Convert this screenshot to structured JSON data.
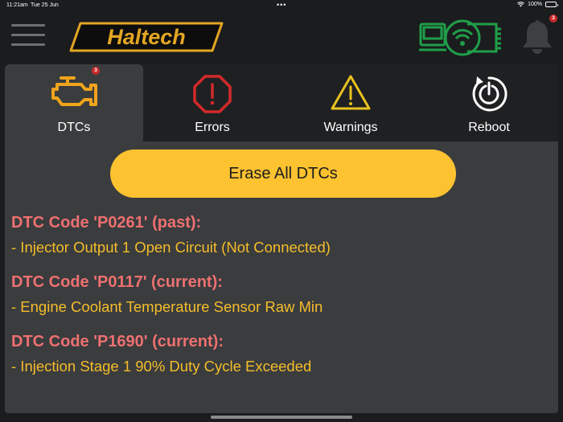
{
  "status_bar": {
    "time": "11:21am",
    "date": "Tue 25 Jun",
    "dots": "•••",
    "battery": "100%"
  },
  "header": {
    "brand": "Haltech",
    "notification_count": "3"
  },
  "colors": {
    "accent_yellow": "#fcc230",
    "dtc_code_red": "#ee7070",
    "dtc_desc_yellow": "#f5bd2a",
    "engine_icon_orange": "#f0a41c",
    "error_icon_red": "#d42a2a",
    "warning_icon_yellow": "#e8c21f",
    "ecu_connected_green": "#1f9e49"
  },
  "tabs": [
    {
      "label": "DTCs",
      "icon": "engine-check-icon",
      "badge": "3",
      "active": true
    },
    {
      "label": "Errors",
      "icon": "error-octagon-icon"
    },
    {
      "label": "Warnings",
      "icon": "warning-triangle-icon"
    },
    {
      "label": "Reboot",
      "icon": "reboot-power-icon"
    }
  ],
  "main": {
    "erase_label": "Erase All DTCs",
    "dtcs": [
      {
        "code": "DTC Code 'P0261' (past):",
        "description": "- Injector Output 1 Open Circuit (Not Connected)"
      },
      {
        "code": "DTC Code 'P0117' (current):",
        "description": "- Engine Coolant Temperature Sensor Raw Min"
      },
      {
        "code": "DTC Code 'P1690' (current):",
        "description": "- Injection Stage 1 90% Duty Cycle Exceeded"
      }
    ]
  }
}
